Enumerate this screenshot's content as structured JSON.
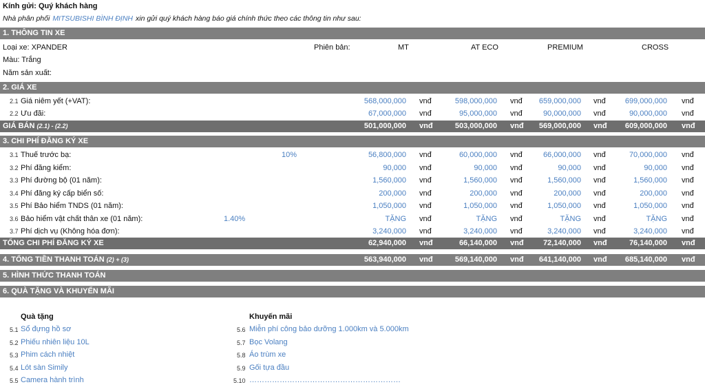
{
  "greeting": "Kính gửi: Quý khách hàng",
  "intro": {
    "before": "Nhà phân phối",
    "dealer": "MITSUBISHI BÌNH ĐỊNH",
    "after": "xin gửi quý khách hàng báo giá chính thức theo các thông tin như sau:"
  },
  "section1": {
    "title": "1. THÔNG TIN XE",
    "car_type": "Loại xe: XPANDER",
    "version_label": "Phiên bản:",
    "versions": [
      "MT",
      "AT ECO",
      "PREMIUM",
      "CROSS"
    ],
    "color": "Màu: Trắng",
    "year": "Năm sản xuất:"
  },
  "unit": "vnđ",
  "section2": {
    "title": "2. GIÁ XE",
    "rows": [
      {
        "no": "2.1",
        "label": "Giá niêm yết (+VAT):",
        "values": [
          "568,000,000",
          "598,000,000",
          "659,000,000",
          "699,000,000"
        ]
      },
      {
        "no": "2.2",
        "label": "Ưu đãi:",
        "values": [
          "67,000,000",
          "95,000,000",
          "90,000,000",
          "90,000,000"
        ]
      }
    ],
    "total": {
      "label": "GIÁ BÁN",
      "suffix": "(2.1) - (2.2)",
      "values": [
        "501,000,000",
        "503,000,000",
        "569,000,000",
        "609,000,000"
      ]
    }
  },
  "section3": {
    "title": "3. CHI PHÍ ĐĂNG KÝ XE",
    "rows": [
      {
        "no": "3.1",
        "label": "Thuế trước bạ:",
        "pct": "10%",
        "values": [
          "56,800,000",
          "60,000,000",
          "66,000,000",
          "70,000,000"
        ]
      },
      {
        "no": "3.2",
        "label": "Phí đăng kiểm:",
        "pct": "",
        "values": [
          "90,000",
          "90,000",
          "90,000",
          "90,000"
        ]
      },
      {
        "no": "3.3",
        "label": "Phí đường bộ (01 năm):",
        "pct": "",
        "values": [
          "1,560,000",
          "1,560,000",
          "1,560,000",
          "1,560,000"
        ]
      },
      {
        "no": "3.4",
        "label": "Phí đăng ký cấp biển số:",
        "pct": "",
        "values": [
          "200,000",
          "200,000",
          "200,000",
          "200,000"
        ]
      },
      {
        "no": "3.5",
        "label": "Phí Bảo hiểm TNDS (01 năm):",
        "pct": "",
        "values": [
          "1,050,000",
          "1,050,000",
          "1,050,000",
          "1,050,000"
        ]
      },
      {
        "no": "3.6",
        "label": "Bảo hiểm vật chất thân xe (01 năm):",
        "pct": "1.40%",
        "values": [
          "TẶNG",
          "TẶNG",
          "TẶNG",
          "TẶNG"
        ]
      },
      {
        "no": "3.7",
        "label": "Phí dịch vụ (Không hóa đơn):",
        "pct": "",
        "values": [
          "3,240,000",
          "3,240,000",
          "3,240,000",
          "3,240,000"
        ]
      }
    ],
    "total": {
      "label": "TỔNG CHI PHÍ ĐĂNG KÝ XE",
      "values": [
        "62,940,000",
        "66,140,000",
        "72,140,000",
        "76,140,000"
      ]
    }
  },
  "section4": {
    "title": "4. TỔNG TIỀN THANH TOÁN",
    "suffix": "(2) + (3)",
    "values": [
      "563,940,000",
      "569,140,000",
      "641,140,000",
      "685,140,000"
    ]
  },
  "section5": {
    "title": "5. HÌNH THỨC THANH TOÁN"
  },
  "section6": {
    "title": "6. QUÀ TẶNG VÀ KHUYẾN MÃI",
    "gifts_header": "Quà tặng",
    "promos_header": "Khuyến mãi",
    "gifts": [
      {
        "no": "5.1",
        "text": "Sổ đựng hồ sơ"
      },
      {
        "no": "5.2",
        "text": "Phiếu nhiên liệu 10L"
      },
      {
        "no": "5.3",
        "text": "Phim cách nhiệt"
      },
      {
        "no": "5.4",
        "text": "Lót sàn Simily"
      },
      {
        "no": "5.5",
        "text": "Camera hành trình"
      }
    ],
    "promos": [
      {
        "no": "5.6",
        "text": "Miễn phí công bảo dưỡng 1.000km và 5.000km"
      },
      {
        "no": "5.7",
        "text": "Bọc Volang"
      },
      {
        "no": "5.8",
        "text": "Áo trùm xe"
      },
      {
        "no": "5.9",
        "text": "Gối tựa đầu"
      },
      {
        "no": "5.10",
        "text": "……………………………………………………"
      }
    ]
  }
}
